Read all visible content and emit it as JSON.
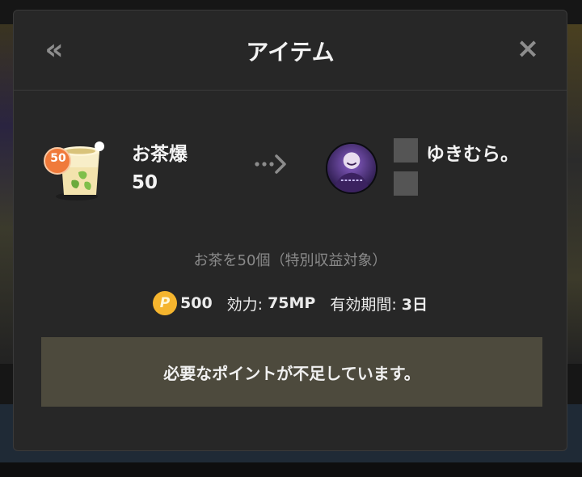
{
  "modal": {
    "title": "アイテム",
    "back_icon": "«",
    "close_icon": "×"
  },
  "item": {
    "name": "お茶爆",
    "quantity": "50",
    "icon": "tea-cup-icon",
    "icon_badge": "50"
  },
  "recipient": {
    "name": "ゆきむら。",
    "icon": "user-avatar"
  },
  "description": "お茶を50個（特別収益対象）",
  "stats": {
    "price": "500",
    "coin_symbol": "P",
    "effect_label": "効力:",
    "effect_value": "75MP",
    "period_label": "有効期間:",
    "period_value": "3日"
  },
  "warning": "必要なポイントが不足しています。",
  "colors": {
    "modal_bg": "#272727",
    "coin": "#f5b52e",
    "warning_bg": "#4d4a3d",
    "badge": "#f07a3a"
  }
}
